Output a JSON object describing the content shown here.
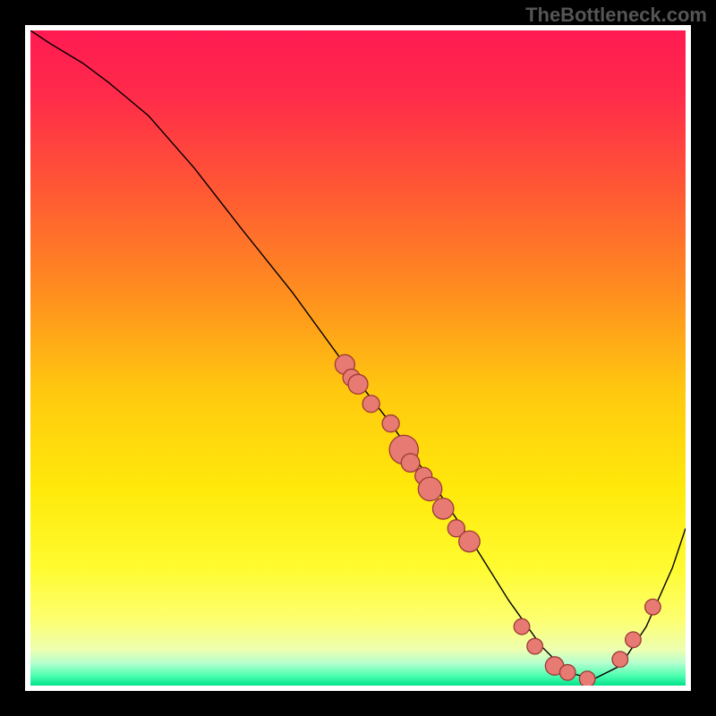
{
  "watermark": "TheBottleneck.com",
  "colors": {
    "gradient_stops": [
      {
        "offset": 0.0,
        "color": "#ff1a52"
      },
      {
        "offset": 0.1,
        "color": "#ff2b4a"
      },
      {
        "offset": 0.25,
        "color": "#ff5a33"
      },
      {
        "offset": 0.4,
        "color": "#ff8e1f"
      },
      {
        "offset": 0.55,
        "color": "#ffc80f"
      },
      {
        "offset": 0.7,
        "color": "#ffe90a"
      },
      {
        "offset": 0.82,
        "color": "#fffb30"
      },
      {
        "offset": 0.9,
        "color": "#fdff70"
      },
      {
        "offset": 0.945,
        "color": "#eeffb0"
      },
      {
        "offset": 0.965,
        "color": "#b7ffce"
      },
      {
        "offset": 0.985,
        "color": "#4dffb0"
      },
      {
        "offset": 1.0,
        "color": "#00e28a"
      }
    ],
    "curve_stroke": "#000000",
    "marker_fill": "#e77a72",
    "marker_stroke": "#9c3b36",
    "background": "#000000",
    "plot_bg": "#ffffff"
  },
  "chart_data": {
    "type": "line",
    "title": "",
    "xlabel": "",
    "ylabel": "",
    "xlim": [
      0,
      100
    ],
    "ylim": [
      0,
      100
    ],
    "series": [
      {
        "name": "bottleneck-curve",
        "x": [
          0,
          3,
          8,
          12,
          18,
          25,
          32,
          40,
          48,
          55,
          62,
          68,
          73,
          78,
          82,
          86,
          90,
          94,
          98,
          100
        ],
        "y": [
          100,
          98,
          95,
          92,
          87,
          79,
          70,
          60,
          49,
          40,
          30,
          21,
          13,
          6,
          2,
          1,
          3,
          9,
          18,
          24
        ]
      }
    ],
    "markers": [
      {
        "x": 48,
        "y": 49,
        "r": 1.5
      },
      {
        "x": 49,
        "y": 47,
        "r": 1.3
      },
      {
        "x": 50,
        "y": 46,
        "r": 1.5
      },
      {
        "x": 52,
        "y": 43,
        "r": 1.3
      },
      {
        "x": 55,
        "y": 40,
        "r": 1.3
      },
      {
        "x": 57,
        "y": 36,
        "r": 2.2
      },
      {
        "x": 58,
        "y": 34,
        "r": 1.4
      },
      {
        "x": 60,
        "y": 32,
        "r": 1.3
      },
      {
        "x": 61,
        "y": 30,
        "r": 1.8
      },
      {
        "x": 63,
        "y": 27,
        "r": 1.6
      },
      {
        "x": 65,
        "y": 24,
        "r": 1.3
      },
      {
        "x": 67,
        "y": 22,
        "r": 1.6
      },
      {
        "x": 75,
        "y": 9,
        "r": 1.2
      },
      {
        "x": 77,
        "y": 6,
        "r": 1.2
      },
      {
        "x": 80,
        "y": 3,
        "r": 1.4
      },
      {
        "x": 82,
        "y": 2,
        "r": 1.2
      },
      {
        "x": 85,
        "y": 1,
        "r": 1.2
      },
      {
        "x": 90,
        "y": 4,
        "r": 1.2
      },
      {
        "x": 92,
        "y": 7,
        "r": 1.2
      },
      {
        "x": 95,
        "y": 12,
        "r": 1.2
      }
    ]
  }
}
